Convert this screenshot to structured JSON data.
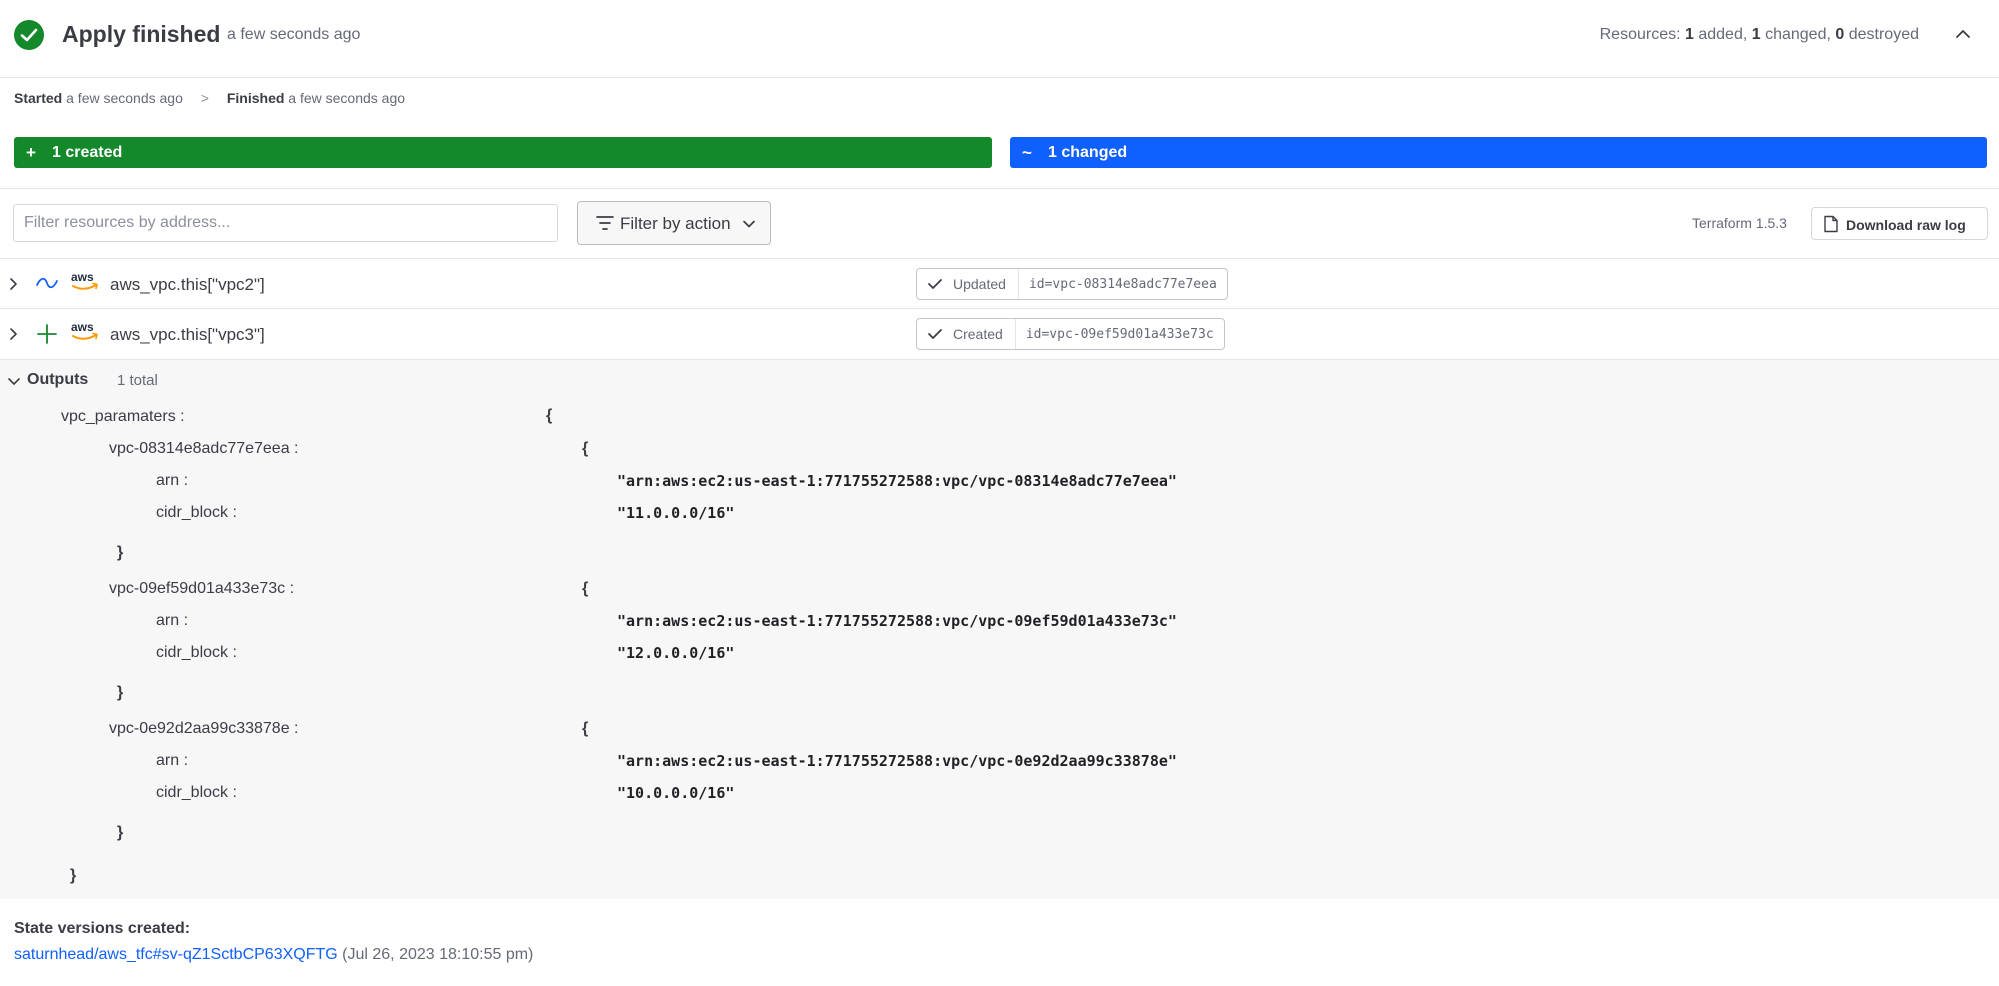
{
  "header": {
    "title": "Apply finished",
    "time": "a few seconds ago",
    "resources_prefix": "Resources: ",
    "added_count": "1",
    "added_label": " added, ",
    "changed_count": "1",
    "changed_label": " changed, ",
    "destroyed_count": "0",
    "destroyed_label": " destroyed",
    "status_color": "#14892c"
  },
  "timeline": {
    "started_label": "Started",
    "started_time": "a few seconds ago",
    "separator": ">",
    "finished_label": "Finished",
    "finished_time": "a few seconds ago"
  },
  "summary_bars": {
    "created": {
      "symbol": "+",
      "label": "1 created",
      "color": "#14892c"
    },
    "changed": {
      "symbol": "~",
      "label": "1 changed",
      "color": "#1060ff"
    }
  },
  "toolbar": {
    "filter_placeholder": "Filter resources by address...",
    "filter_action_label": "Filter by action",
    "terraform_version": "Terraform 1.5.3",
    "download_label": "Download raw log"
  },
  "resources": [
    {
      "action_icon": "tilde-icon",
      "provider": "aws",
      "address": "aws_vpc.this[\"vpc2\"]",
      "state": "Updated",
      "id": "id=vpc-08314e8adc77e7eea"
    },
    {
      "action_icon": "plus-icon",
      "provider": "aws",
      "address": "aws_vpc.this[\"vpc3\"]",
      "state": "Created",
      "id": "id=vpc-09ef59d01a433e73c"
    }
  ],
  "outputs": {
    "title": "Outputs",
    "total": "1 total",
    "root_key": "vpc_paramaters :",
    "open_brace": "{",
    "close_brace": "}",
    "vpcs": [
      {
        "key": "vpc-08314e8adc77e7eea :",
        "arn_key": "arn :",
        "arn": "\"arn:aws:ec2:us-east-1:771755272588:vpc/vpc-08314e8adc77e7eea\"",
        "cidr_key": "cidr_block :",
        "cidr": "\"11.0.0.0/16\""
      },
      {
        "key": "vpc-09ef59d01a433e73c :",
        "arn_key": "arn :",
        "arn": "\"arn:aws:ec2:us-east-1:771755272588:vpc/vpc-09ef59d01a433e73c\"",
        "cidr_key": "cidr_block :",
        "cidr": "\"12.0.0.0/16\""
      },
      {
        "key": "vpc-0e92d2aa99c33878e :",
        "arn_key": "arn :",
        "arn": "\"arn:aws:ec2:us-east-1:771755272588:vpc/vpc-0e92d2aa99c33878e\"",
        "cidr_key": "cidr_block :",
        "cidr": "\"10.0.0.0/16\""
      }
    ]
  },
  "state_versions": {
    "title": "State versions created:",
    "link": "saturnhead/aws_tfc#sv-qZ1SctbCP63XQFTG",
    "date": " (Jul 26, 2023 18:10:55 pm)"
  }
}
